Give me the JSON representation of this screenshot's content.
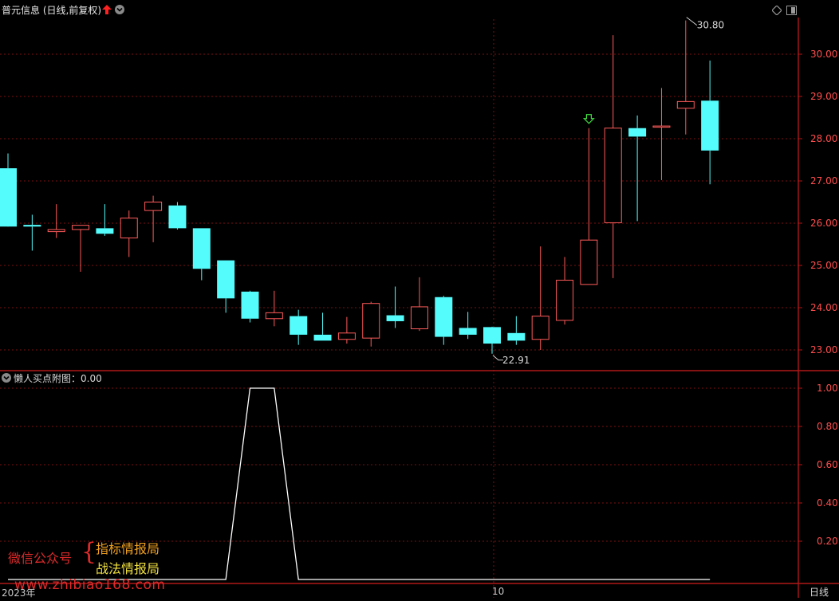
{
  "header": {
    "title": "普元信息",
    "period": "(日线,前复权)",
    "indicator_label": "懒人买点附图",
    "indicator_value": "0.00"
  },
  "footer": {
    "year_label": "2023年",
    "month_label": "10",
    "period_button": "日线"
  },
  "watermark": {
    "wechat": "微信公众号",
    "line1": "指标情报局",
    "line2": "战法情报局",
    "site": "www.zhibiao168.com"
  },
  "colors": {
    "up": "#ff5a5a",
    "down": "#54fcfc",
    "grid": "#7a1010",
    "axis": "#b01818",
    "signal_arrow": "#40e040",
    "indicator_line": "#ffffff",
    "axis_text": "#ff4d4d"
  },
  "chart_data": [
    {
      "type": "candlestick",
      "title": "普元信息 (日线,前复权)",
      "ylim": [
        22.7,
        31.2
      ],
      "y_ticks": [
        "30.00",
        "29.00",
        "28.00",
        "27.00",
        "26.00",
        "25.00",
        "24.00",
        "23.00"
      ],
      "annotations": [
        {
          "label": "30.80",
          "candle_index": 28,
          "value": 30.8,
          "kind": "high"
        },
        {
          "label": "22.91",
          "candle_index": 20,
          "value": 22.91,
          "kind": "low"
        }
      ],
      "signal": {
        "candle_index": 24,
        "marker": "down-arrow"
      },
      "candles": [
        {
          "o": 27.3,
          "h": 27.65,
          "l": 26.95,
          "c": 25.92
        },
        {
          "o": 25.96,
          "h": 26.2,
          "l": 25.35,
          "c": 25.92
        },
        {
          "o": 25.8,
          "h": 26.45,
          "l": 25.65,
          "c": 25.85
        },
        {
          "o": 25.85,
          "h": 25.95,
          "l": 24.85,
          "c": 25.95
        },
        {
          "o": 25.88,
          "h": 26.45,
          "l": 25.7,
          "c": 25.75
        },
        {
          "o": 25.65,
          "h": 26.3,
          "l": 25.2,
          "c": 26.12
        },
        {
          "o": 26.3,
          "h": 26.65,
          "l": 25.55,
          "c": 26.5
        },
        {
          "o": 26.42,
          "h": 26.5,
          "l": 25.85,
          "c": 25.88
        },
        {
          "o": 25.88,
          "h": 25.88,
          "l": 24.65,
          "c": 24.92
        },
        {
          "o": 25.12,
          "h": 25.12,
          "l": 23.88,
          "c": 24.22
        },
        {
          "o": 24.38,
          "h": 24.4,
          "l": 23.65,
          "c": 23.74
        },
        {
          "o": 23.74,
          "h": 24.4,
          "l": 23.56,
          "c": 23.88
        },
        {
          "o": 23.8,
          "h": 23.95,
          "l": 23.12,
          "c": 23.36
        },
        {
          "o": 23.36,
          "h": 23.88,
          "l": 23.22,
          "c": 23.22
        },
        {
          "o": 23.25,
          "h": 23.78,
          "l": 23.15,
          "c": 23.4
        },
        {
          "o": 23.28,
          "h": 24.14,
          "l": 23.08,
          "c": 24.1
        },
        {
          "o": 23.82,
          "h": 24.5,
          "l": 23.52,
          "c": 23.68
        },
        {
          "o": 23.5,
          "h": 24.72,
          "l": 23.45,
          "c": 24.02
        },
        {
          "o": 24.25,
          "h": 24.28,
          "l": 23.12,
          "c": 23.31
        },
        {
          "o": 23.52,
          "h": 23.9,
          "l": 23.26,
          "c": 23.36
        },
        {
          "o": 23.54,
          "h": 23.55,
          "l": 22.91,
          "c": 23.15
        },
        {
          "o": 23.4,
          "h": 23.8,
          "l": 23.12,
          "c": 23.22
        },
        {
          "o": 23.25,
          "h": 25.45,
          "l": 23.0,
          "c": 23.8
        },
        {
          "o": 23.7,
          "h": 25.2,
          "l": 23.6,
          "c": 24.65
        },
        {
          "o": 24.55,
          "h": 28.25,
          "l": 24.55,
          "c": 25.6
        },
        {
          "o": 26.01,
          "h": 30.45,
          "l": 24.7,
          "c": 28.25
        },
        {
          "o": 28.25,
          "h": 28.55,
          "l": 26.05,
          "c": 28.05
        },
        {
          "o": 28.3,
          "h": 29.2,
          "l": 27.02,
          "c": 28.3
        },
        {
          "o": 28.72,
          "h": 30.8,
          "l": 28.1,
          "c": 28.88
        },
        {
          "o": 28.9,
          "h": 29.85,
          "l": 26.92,
          "c": 27.72
        }
      ]
    },
    {
      "type": "line",
      "title": "懒人买点附图",
      "ylim": [
        0,
        1.08
      ],
      "y_ticks": [
        "1.00",
        "0.80",
        "0.60",
        "0.40",
        "0.20"
      ],
      "series": [
        {
          "values": [
            0,
            0,
            0,
            0,
            0,
            0,
            0,
            0,
            0,
            0,
            1,
            1,
            0,
            0,
            0,
            0,
            0,
            0,
            0,
            0,
            0,
            0,
            0,
            0,
            0,
            0,
            0,
            0,
            0,
            0
          ]
        }
      ]
    }
  ]
}
